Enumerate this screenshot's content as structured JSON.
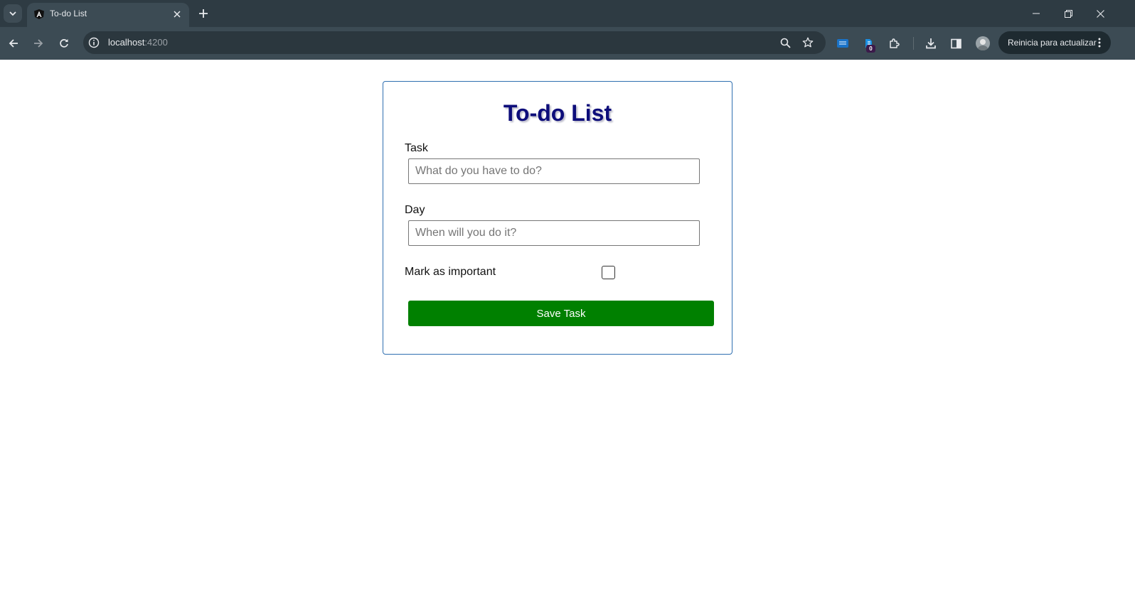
{
  "browser": {
    "tab_title": "To-do List",
    "url_host": "localhost",
    "url_port": ":4200",
    "update_label": "Reinicia para actualizar",
    "extension_badge": "0",
    "icons": [
      "tab-search-icon",
      "angular-favicon-icon",
      "close-icon",
      "new-tab-icon",
      "minimize-icon",
      "restore-icon",
      "back-icon",
      "forward-icon",
      "reload-icon",
      "info-icon",
      "zoom-icon",
      "star-icon",
      "extension-icon",
      "puzzle-icon",
      "download-icon",
      "side-panel-icon",
      "avatar",
      "more-icon"
    ]
  },
  "app": {
    "title": "To-do List",
    "task_label": "Task",
    "task_placeholder": "What do you have to do?",
    "day_label": "Day",
    "day_placeholder": "When will you do it?",
    "important_label": "Mark as important",
    "important_checked": false,
    "save_label": "Save Task",
    "colors": {
      "title": "#0d0d7a",
      "card_border": "#2f6fb0",
      "save_button": "#008000",
      "chrome_frame": "#2e3b43",
      "chrome_toolbar": "#3c4b54"
    }
  }
}
